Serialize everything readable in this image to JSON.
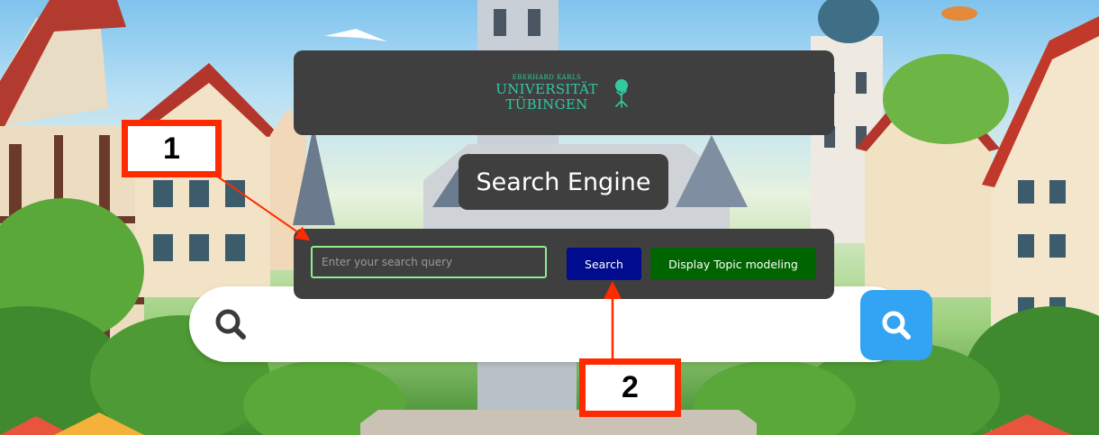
{
  "header": {
    "logo": {
      "small_text": "EBERHARD KARLS",
      "line1": "UNIVERSITÄT",
      "line2": "TÜBINGEN",
      "color": "#33c9a0"
    }
  },
  "title": "Search Engine",
  "search": {
    "placeholder": "Enter your search query",
    "value": "",
    "search_label": "Search",
    "topic_label": "Display Topic modeling"
  },
  "annotations": {
    "callout_1": "1",
    "callout_2": "2",
    "color": "#ff2a00"
  },
  "colors": {
    "panel": "#3f3f3f",
    "search_button": "#000b8e",
    "topic_button": "#006400",
    "input_border": "#90ee90"
  }
}
